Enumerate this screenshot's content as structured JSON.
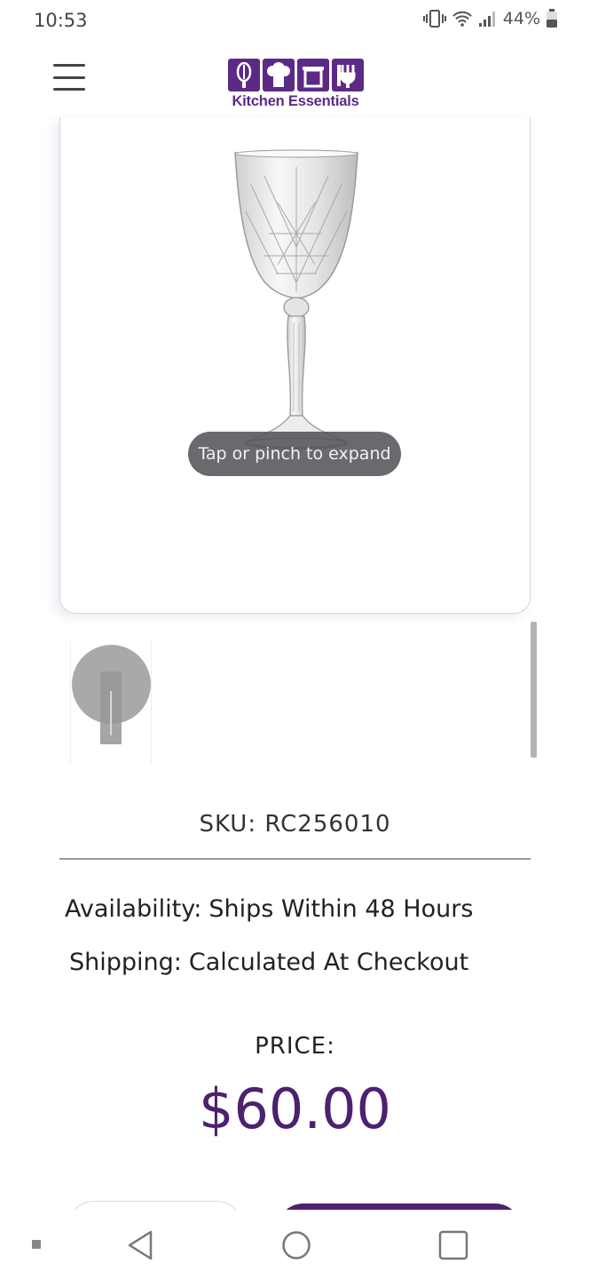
{
  "status_bar": {
    "time": "10:53",
    "battery": "44%",
    "icons": [
      "vibrate-icon",
      "wifi-icon",
      "signal-icon",
      "battery-icon"
    ]
  },
  "header": {
    "brand_name": "Kitchen Essentials",
    "brand_color": "#5b2a86",
    "menu_icon": "hamburger-menu-icon"
  },
  "product": {
    "image_hint": "Tap or pinch to expand",
    "sku_label": "SKU:",
    "sku_value": "RC256010",
    "availability_label": "Availability:",
    "availability_value": "Ships Within 48 Hours",
    "shipping_label": "Shipping:",
    "shipping_value": "Calculated At Checkout",
    "price_label": "PRICE:",
    "price_value": "$60.00",
    "price_color": "#4b2170"
  },
  "nav_bar": {
    "icons": [
      "back-icon",
      "home-icon",
      "recent-apps-icon"
    ]
  }
}
